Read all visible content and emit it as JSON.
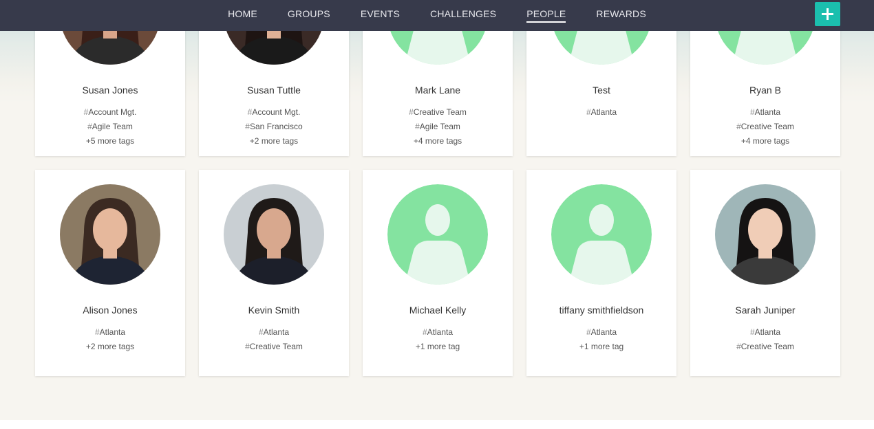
{
  "nav": {
    "items": [
      {
        "label": "HOME",
        "active": false
      },
      {
        "label": "GROUPS",
        "active": false
      },
      {
        "label": "EVENTS",
        "active": false
      },
      {
        "label": "CHALLENGES",
        "active": false
      },
      {
        "label": "PEOPLE",
        "active": true
      },
      {
        "label": "REWARDS",
        "active": false
      }
    ],
    "add_button_icon": "plus-icon",
    "accent_color": "#1bbfae"
  },
  "people": [
    {
      "name": "Susan Jones",
      "avatar": "photo",
      "tags": [
        "Account Mgt.",
        "Agile Team"
      ],
      "more": "+5 more tags"
    },
    {
      "name": "Susan Tuttle",
      "avatar": "photo",
      "tags": [
        "Account Mgt.",
        "San Francisco"
      ],
      "more": "+2 more tags"
    },
    {
      "name": "Mark Lane",
      "avatar": "placeholder",
      "tags": [
        "Creative Team",
        "Agile Team"
      ],
      "more": "+4 more tags"
    },
    {
      "name": "Test",
      "avatar": "placeholder",
      "tags": [
        "Atlanta"
      ],
      "more": ""
    },
    {
      "name": "Ryan B",
      "avatar": "placeholder",
      "tags": [
        "Atlanta",
        "Creative Team"
      ],
      "more": "+4 more tags"
    },
    {
      "name": "Alison Jones",
      "avatar": "photo",
      "tags": [
        "Atlanta"
      ],
      "more": "+2 more tags"
    },
    {
      "name": "Kevin Smith",
      "avatar": "photo",
      "tags": [
        "Atlanta",
        "Creative Team"
      ],
      "more": ""
    },
    {
      "name": "Michael Kelly",
      "avatar": "placeholder",
      "tags": [
        "Atlanta"
      ],
      "more": "+1 more tag"
    },
    {
      "name": "tiffany smithfieldson",
      "avatar": "placeholder",
      "tags": [
        "Atlanta"
      ],
      "more": "+1 more tag"
    },
    {
      "name": "Sarah Juniper",
      "avatar": "photo",
      "tags": [
        "Atlanta",
        "Creative Team"
      ],
      "more": ""
    }
  ],
  "colors": {
    "navbar": "#373a4b",
    "placeholder_avatar_bg": "#84e3a0",
    "placeholder_avatar_fg": "#e6f7ec"
  }
}
